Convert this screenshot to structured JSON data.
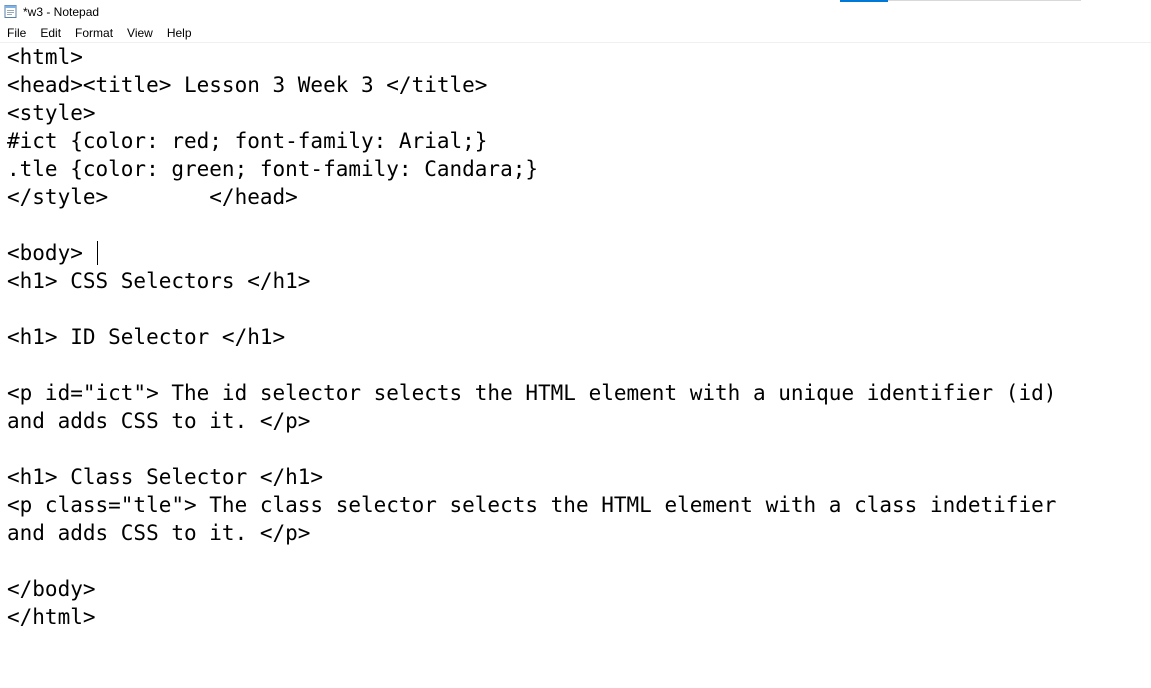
{
  "window": {
    "title": "*w3 - Notepad"
  },
  "menu": {
    "items": [
      "File",
      "Edit",
      "Format",
      "View",
      "Help"
    ]
  },
  "icons": {
    "app": "notepad-icon"
  },
  "colors": {
    "accent": "#0078d7",
    "rule": "#d9d9d9"
  },
  "editor": {
    "lines": [
      "<html>",
      "<head><title> Lesson 3 Week 3 </title>",
      "<style>",
      "#ict {color: red; font-family: Arial;}",
      ".tle {color: green; font-family: Candara;}",
      "</style>        </head>",
      "",
      "<body> ",
      "<h1> CSS Selectors </h1>",
      "",
      "<h1> ID Selector </h1>",
      "",
      "<p id=\"ict\"> The id selector selects the HTML element with a unique identifier (id)",
      "and adds CSS to it. </p>",
      "",
      "<h1> Class Selector </h1>",
      "<p class=\"tle\"> The class selector selects the HTML element with a class indetifier",
      "and adds CSS to it. </p>",
      "",
      "</body>",
      "</html>"
    ]
  }
}
